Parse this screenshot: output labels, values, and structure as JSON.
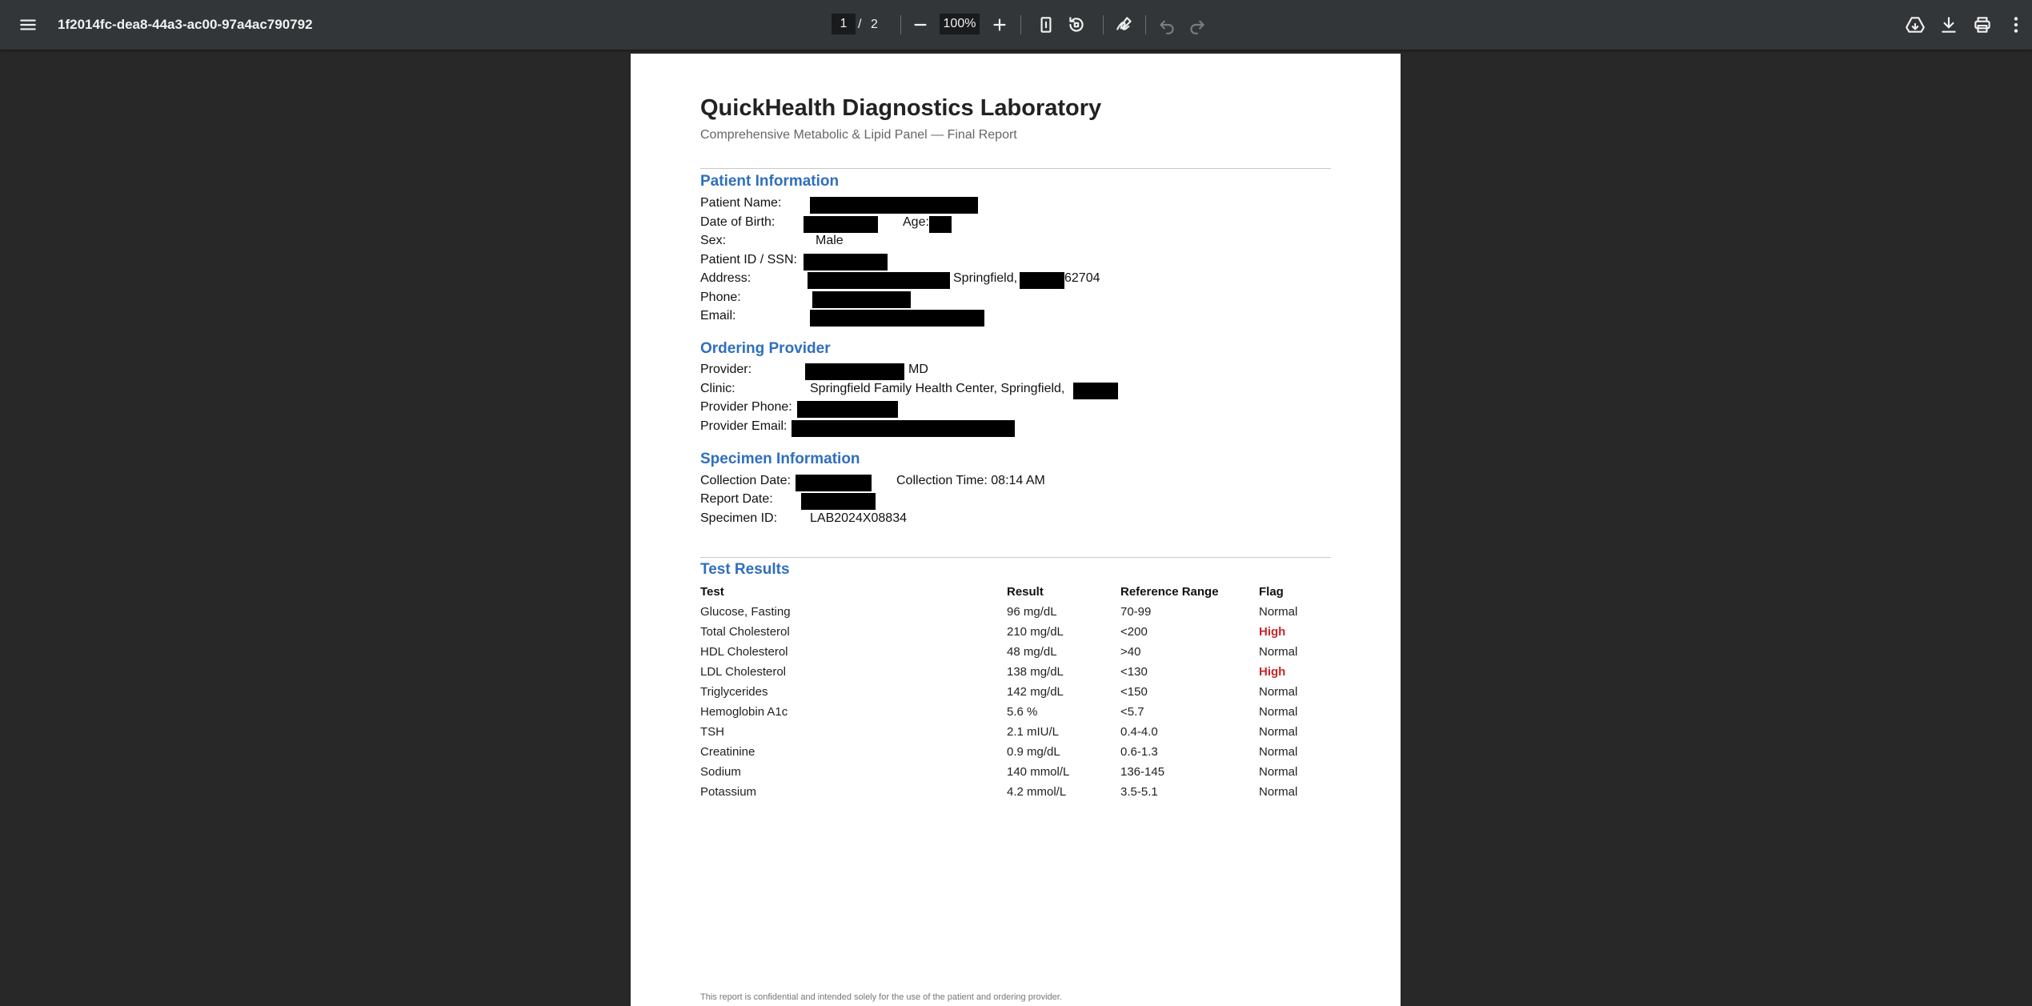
{
  "toolbar": {
    "file_name": "1f2014fc-dea8-44a3-ac00-97a4ac790792",
    "current_page": "1",
    "page_separator": "/",
    "total_pages": "2",
    "zoom": "100%",
    "icons": [
      "menu-icon",
      "zoom-out-icon",
      "zoom-in-icon",
      "fit-page-icon",
      "rotate-icon",
      "annotate-icon",
      "undo-icon",
      "redo-icon",
      "drive-icon",
      "download-icon",
      "print-icon",
      "more-icon"
    ]
  },
  "document": {
    "title": "QuickHealth Diagnostics Laboratory",
    "subtitle": "Comprehensive Metabolic & Lipid Panel — Final Report",
    "patient": {
      "heading": "Patient Information",
      "name_label": "Patient Name:",
      "dob_label": "Date of Birth:",
      "age_label": "Age:",
      "sex_label": "Sex:",
      "sex_value": "Male",
      "id_label": "Patient ID / SSN:",
      "address_label": "Address:",
      "address_city": "Springfield,",
      "address_zip": "62704",
      "phone_label": "Phone:",
      "email_label": "Email:"
    },
    "provider": {
      "heading": "Ordering Provider",
      "provider_label": "Provider:",
      "provider_suffix": "MD",
      "clinic_label": "Clinic:",
      "clinic_value": "Springfield Family Health Center, Springfield,",
      "phone_label": "Provider Phone:",
      "email_label": "Provider Email:"
    },
    "specimen": {
      "heading": "Specimen Information",
      "collection_date_label": "Collection Date:",
      "collection_time": "Collection Time: 08:14 AM",
      "report_date_label": "Report Date:",
      "specimen_id_label": "Specimen ID:",
      "specimen_id_value": "LAB2024X08834"
    },
    "results": {
      "heading": "Test Results",
      "columns": [
        "Test",
        "Result",
        "Reference Range",
        "Flag"
      ],
      "rows": [
        {
          "test": "Glucose, Fasting",
          "result": "96 mg/dL",
          "range": "70-99",
          "flag": "Normal"
        },
        {
          "test": "Total Cholesterol",
          "result": "210 mg/dL",
          "range": "<200",
          "flag": "High"
        },
        {
          "test": "HDL Cholesterol",
          "result": "48 mg/dL",
          "range": ">40",
          "flag": "Normal"
        },
        {
          "test": "LDL Cholesterol",
          "result": "138 mg/dL",
          "range": "<130",
          "flag": "High"
        },
        {
          "test": "Triglycerides",
          "result": "142 mg/dL",
          "range": "<150",
          "flag": "Normal"
        },
        {
          "test": "Hemoglobin A1c",
          "result": "5.6 %",
          "range": "<5.7",
          "flag": "Normal"
        },
        {
          "test": "TSH",
          "result": "2.1 mIU/L",
          "range": "0.4-4.0",
          "flag": "Normal"
        },
        {
          "test": "Creatinine",
          "result": "0.9 mg/dL",
          "range": "0.6-1.3",
          "flag": "Normal"
        },
        {
          "test": "Sodium",
          "result": "140 mmol/L",
          "range": "136-145",
          "flag": "Normal"
        },
        {
          "test": "Potassium",
          "result": "4.2 mmol/L",
          "range": "3.5-5.1",
          "flag": "Normal"
        }
      ]
    },
    "footer_note": "This report is confidential and intended solely for the use of the patient and ordering provider."
  },
  "colors": {
    "toolbar_bg": "#323639",
    "viewer_bg": "#282828",
    "heading_blue": "#2f6fbd",
    "flag_high_red": "#c62828"
  }
}
